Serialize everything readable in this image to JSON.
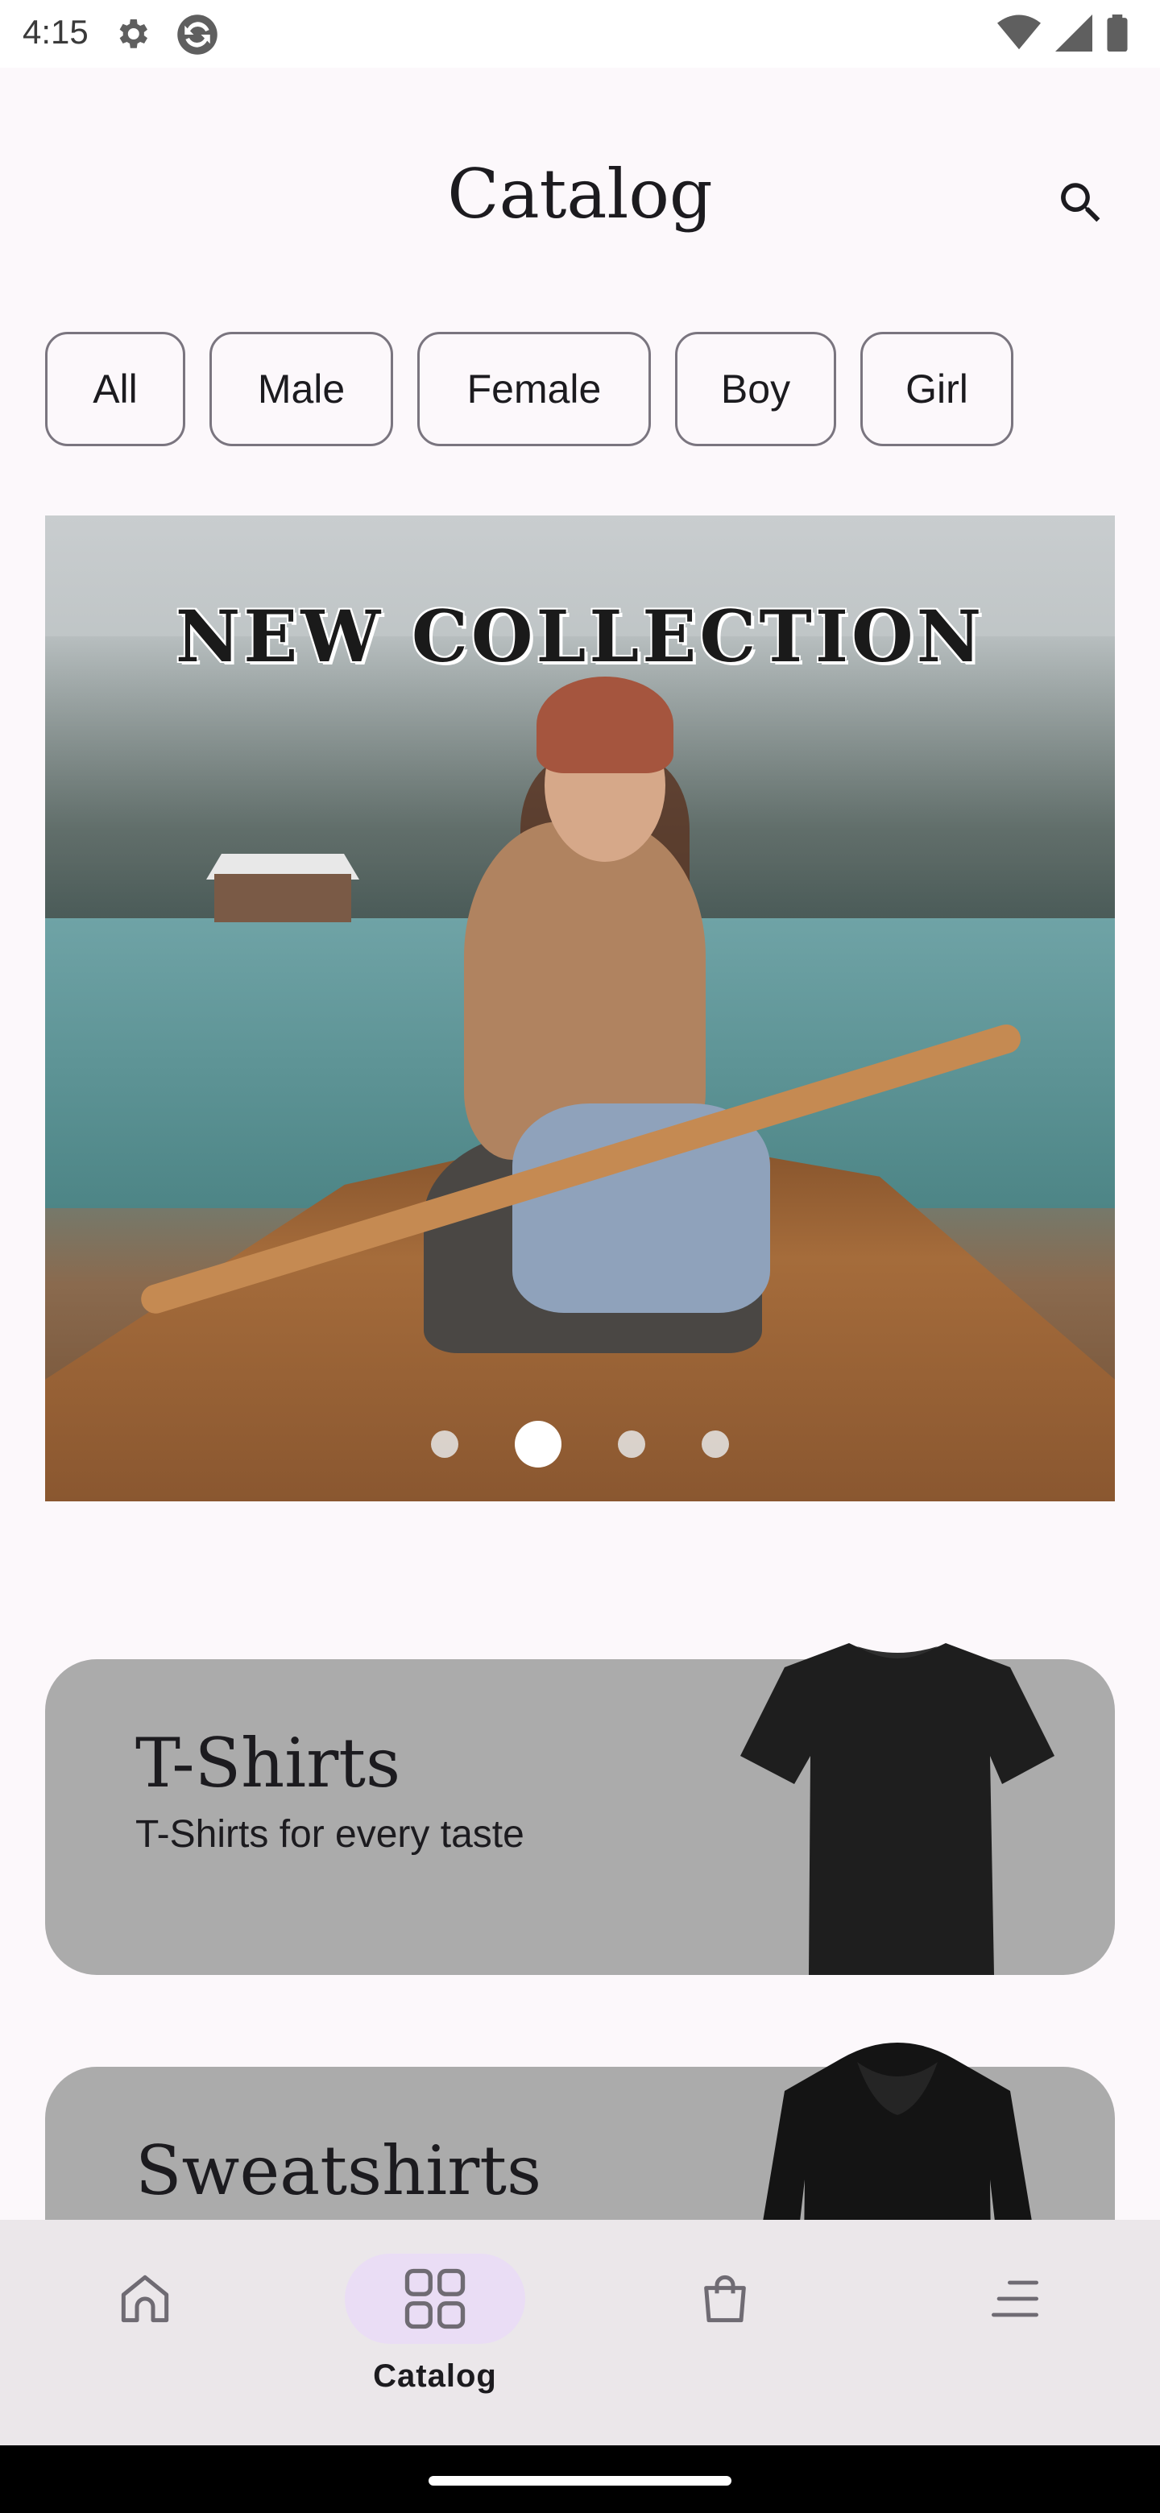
{
  "status_bar": {
    "time": "4:15"
  },
  "header": {
    "title": "Catalog"
  },
  "filters": {
    "chips": [
      "All",
      "Male",
      "Female",
      "Boy",
      "Girl"
    ]
  },
  "banner": {
    "title": "NEW COLLECTION",
    "active_index": 1,
    "total": 4
  },
  "categories": [
    {
      "title": "T-Shirts",
      "subtitle": "T-Shirts for every taste"
    },
    {
      "title": "Sweatshirts"
    }
  ],
  "bottom_nav": {
    "selected_label": "Catalog"
  },
  "colors": {
    "card_bg": "#ababab",
    "nav_bg": "#ebe7ea",
    "nav_active_pill": "#eaddf5",
    "page_bg": "#fcf8fb"
  }
}
